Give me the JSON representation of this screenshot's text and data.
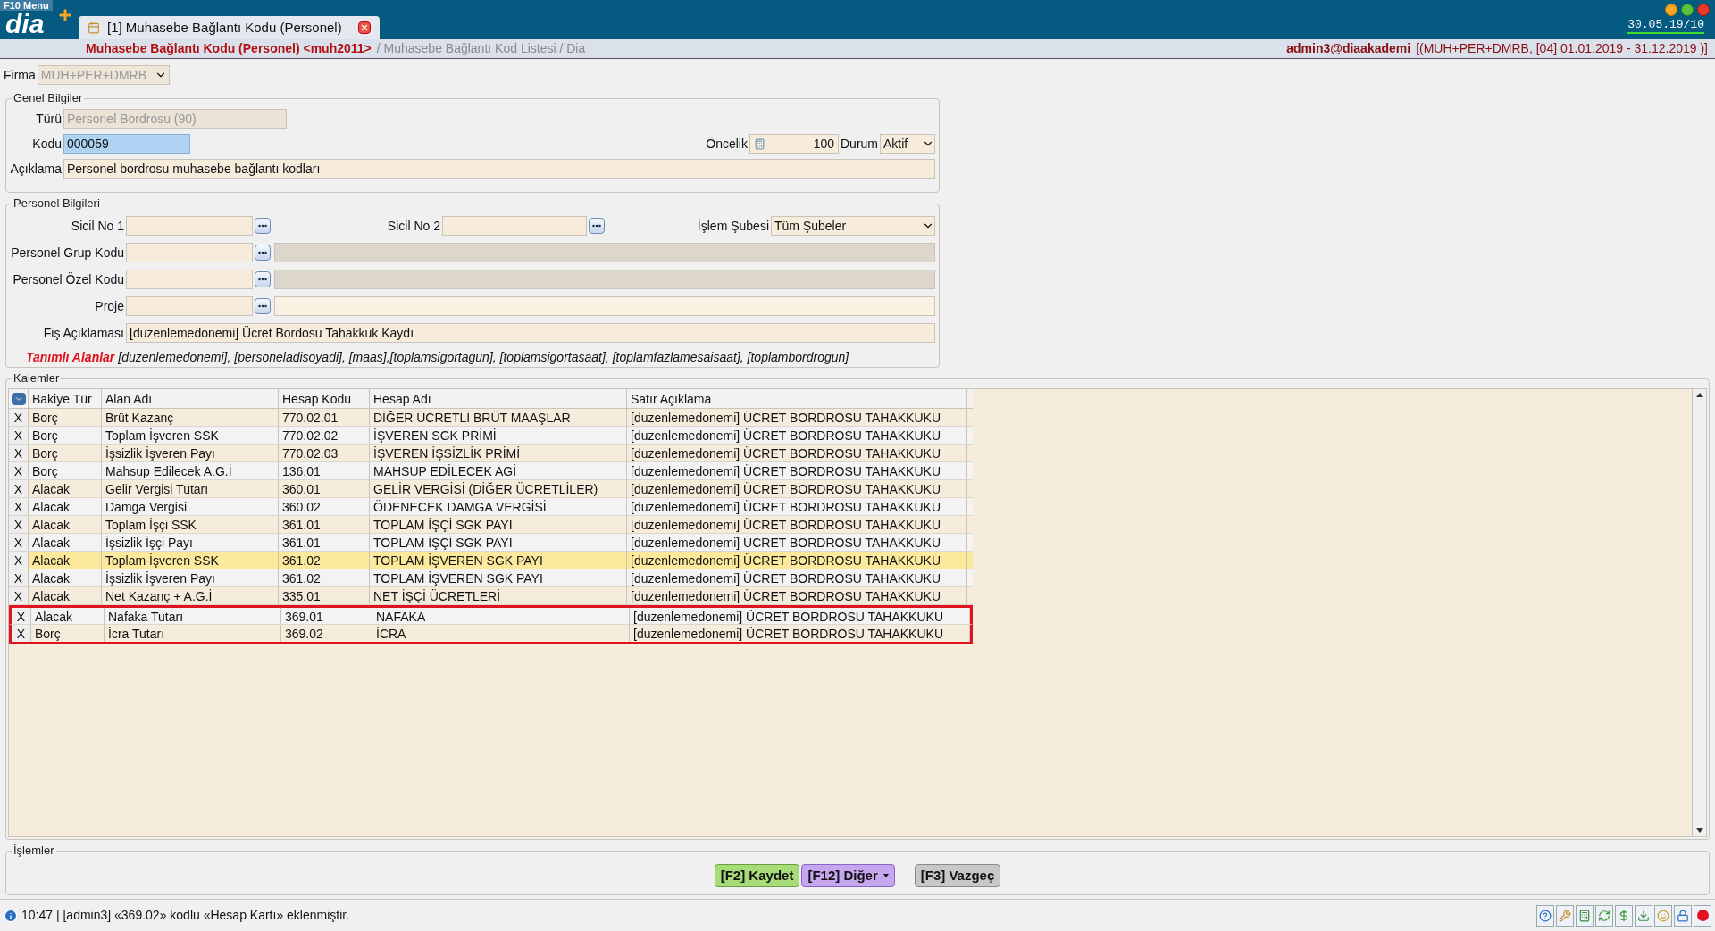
{
  "top_bar": {
    "menu_label": "F10 Menu",
    "logo": "dia",
    "tabs": [
      {
        "label": "[1] Muhasebe Bağlantı Kodu (Personel)",
        "selected": true
      }
    ],
    "date": "30.05.19/10"
  },
  "breadcrumb": {
    "current": "Muhasebe Bağlantı Kodu (Personel) <muh2011>",
    "trail": "/ Muhasebe Bağlantı Kod Listesi / Dia",
    "user": "admin3@diaakademi",
    "period": "[(MUH+PER+DMRB, [04] 01.01.2019 - 31.12.2019 )]"
  },
  "firma": {
    "label": "Firma",
    "value": "MUH+PER+DMRB"
  },
  "genel": {
    "title": "Genel Bilgiler",
    "turu_label": "Türü",
    "turu_value": "Personel Bordrosu (90)",
    "kodu_label": "Kodu",
    "kodu_value": "000059",
    "oncelik_label": "Öncelik",
    "oncelik_value": "100",
    "durum_label": "Durum",
    "durum_value": "Aktif",
    "aciklama_label": "Açıklama",
    "aciklama_value": "Personel bordrosu muhasebe bağlantı kodları"
  },
  "personel": {
    "title": "Personel Bilgileri",
    "sicil1_label": "Sicil No 1",
    "sicil2_label": "Sicil No 2",
    "sube_label": "İşlem Şubesi",
    "sube_value": "Tüm Şubeler",
    "lookups": [
      {
        "label": "Personel Grup Kodu",
        "desc_enabled": false
      },
      {
        "label": "Personel Özel Kodu",
        "desc_enabled": false
      },
      {
        "label": "Proje",
        "desc_enabled": true
      }
    ],
    "fis_label": "Fiş Açıklaması",
    "fis_value": "[duzenlemedonemi] Ücret Bordosu Tahakkuk Kaydı",
    "tanimli_label": "Tanımlı Alanlar",
    "tanimli_value": "[duzenlemedonemi], [personeladisoyadi], [maas],[toplamsigortagun], [toplamsigortasaat], [toplamfazlamesaisaat], [toplambordrogun]"
  },
  "kalemler": {
    "title": "Kalemler",
    "columns": [
      "Bakiye Tür",
      "Alan Adı",
      "Hesap Kodu",
      "Hesap Adı",
      "Satır Açıklama"
    ],
    "rows": [
      {
        "del": "X",
        "cells": [
          "Borç",
          "Brüt Kazanç",
          "770.02.01",
          "DİĞER ÜCRETLİ BRÜT MAAŞLAR",
          "[duzenlemedonemi] ÜCRET BORDROSU TAHAKKUKU"
        ],
        "selected": false,
        "marked": false
      },
      {
        "del": "X",
        "cells": [
          "Borç",
          "Toplam İşveren SSK",
          "770.02.02",
          "İŞVEREN SGK PRİMİ",
          "[duzenlemedonemi] ÜCRET BORDROSU TAHAKKUKU"
        ],
        "selected": false,
        "marked": false
      },
      {
        "del": "X",
        "cells": [
          "Borç",
          "İşsizlik İşveren Payı",
          "770.02.03",
          "İŞVEREN İŞSİZLİK PRİMİ",
          "[duzenlemedonemi] ÜCRET BORDROSU TAHAKKUKU"
        ],
        "selected": false,
        "marked": false
      },
      {
        "del": "X",
        "cells": [
          "Borç",
          "Mahsup Edilecek A.G.İ",
          "136.01",
          "MAHSUP EDİLECEK AGİ",
          "[duzenlemedonemi] ÜCRET BORDROSU TAHAKKUKU"
        ],
        "selected": false,
        "marked": false
      },
      {
        "del": "X",
        "cells": [
          "Alacak",
          "Gelir Vergisi Tutarı",
          "360.01",
          "GELİR VERGİSİ  (DİĞER ÜCRETLİLER)",
          "[duzenlemedonemi] ÜCRET BORDROSU TAHAKKUKU"
        ],
        "selected": false,
        "marked": false
      },
      {
        "del": "X",
        "cells": [
          "Alacak",
          "Damga Vergisi",
          "360.02",
          "ÖDENECEK DAMGA VERGİSİ",
          "[duzenlemedonemi] ÜCRET BORDROSU TAHAKKUKU"
        ],
        "selected": false,
        "marked": false
      },
      {
        "del": "X",
        "cells": [
          "Alacak",
          "Toplam İşçi SSK",
          "361.01",
          "TOPLAM İŞÇİ SGK PAYI",
          "[duzenlemedonemi] ÜCRET BORDROSU TAHAKKUKU"
        ],
        "selected": false,
        "marked": false
      },
      {
        "del": "X",
        "cells": [
          "Alacak",
          "İşsizlik İşçi Payı",
          "361.01",
          "TOPLAM İŞÇİ SGK PAYI",
          "[duzenlemedonemi] ÜCRET BORDROSU TAHAKKUKU"
        ],
        "selected": false,
        "marked": false
      },
      {
        "del": "X",
        "cells": [
          "Alacak",
          "Toplam İşveren SSK",
          "361.02",
          "TOPLAM İŞVEREN SGK PAYI",
          "[duzenlemedonemi] ÜCRET BORDROSU TAHAKKUKU"
        ],
        "selected": true,
        "marked": false
      },
      {
        "del": "X",
        "cells": [
          "Alacak",
          "İşsizlik İşveren Payı",
          "361.02",
          "TOPLAM İŞVEREN SGK PAYI",
          "[duzenlemedonemi] ÜCRET BORDROSU TAHAKKUKU"
        ],
        "selected": false,
        "marked": false
      },
      {
        "del": "X",
        "cells": [
          "Alacak",
          "Net Kazanç + A.G.İ",
          "335.01",
          "NET İŞÇİ ÜCRETLERİ",
          "[duzenlemedonemi] ÜCRET BORDROSU TAHAKKUKU"
        ],
        "selected": false,
        "marked": false
      },
      {
        "del": "X",
        "cells": [
          "Alacak",
          "Nafaka Tutarı",
          "369.01",
          "NAFAKA",
          "[duzenlemedonemi] ÜCRET BORDROSU TAHAKKUKU"
        ],
        "selected": false,
        "marked": true
      },
      {
        "del": "X",
        "cells": [
          "Borç",
          "İcra Tutarı",
          "369.02",
          "İCRA",
          "[duzenlemedonemi] ÜCRET BORDROSU TAHAKKUKU"
        ],
        "selected": false,
        "marked": true
      }
    ]
  },
  "islemler": {
    "title": "İşlemler",
    "buttons": [
      {
        "label": "[F2] Kaydet",
        "kind": "save"
      },
      {
        "label": "[F12] Diğer",
        "kind": "menu"
      },
      {
        "label": "[F3] Vazgeç",
        "kind": "cancel"
      }
    ]
  },
  "status_bar": {
    "message": "10:47 | [admin3] «369.02» kodlu «Hesap Kartı» eklenmiştir."
  }
}
